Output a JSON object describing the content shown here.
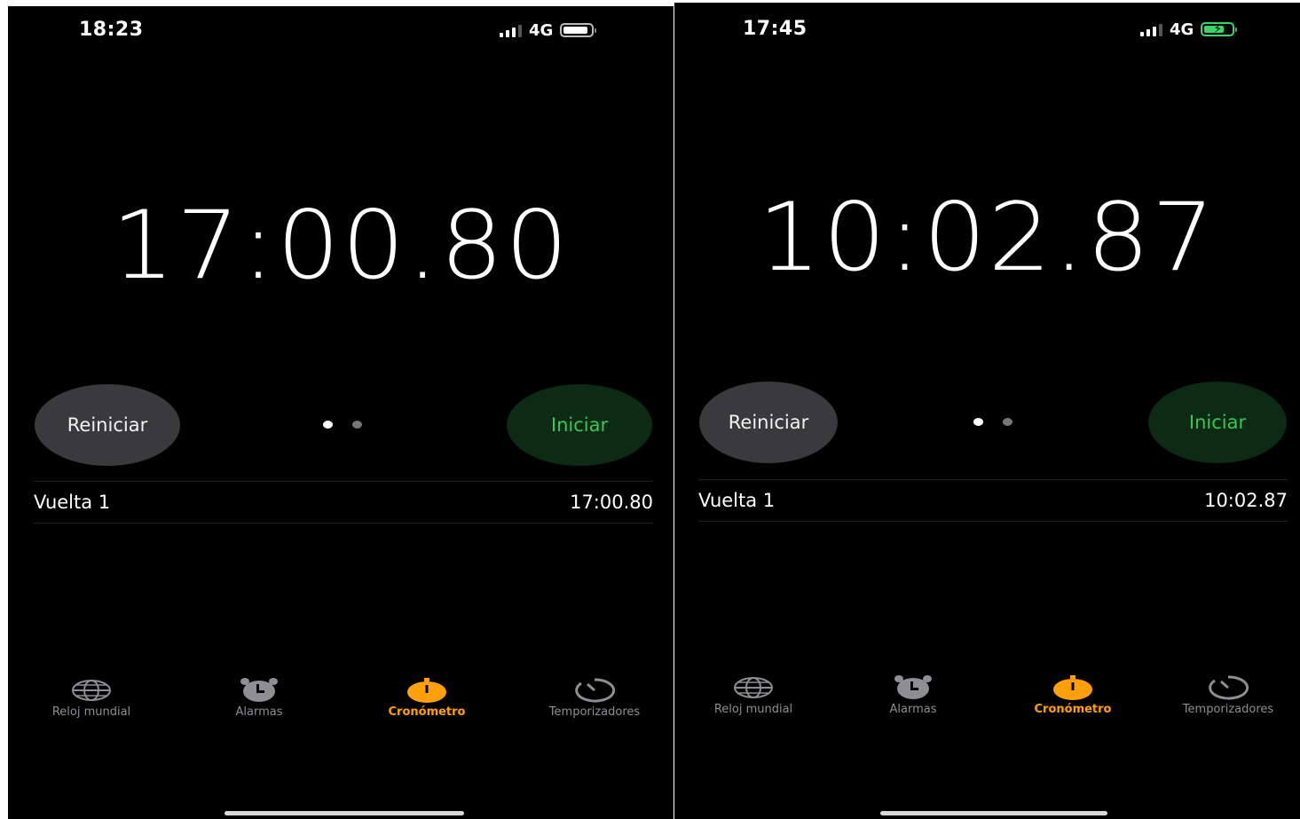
{
  "screens": [
    {
      "status": {
        "time": "18:23",
        "network": "4G",
        "battery_level": 0.9,
        "charging": false
      },
      "stopwatch": {
        "display": "17:00.80"
      },
      "buttons": {
        "reset": "Reiniciar",
        "start": "Iniciar"
      },
      "page_dots": {
        "count": 2,
        "active_index": 0
      },
      "laps": [
        {
          "label": "Vuelta 1",
          "time": "17:00.80"
        }
      ],
      "tabs": [
        {
          "label": "Reloj mundial",
          "icon": "globe-icon",
          "active": false
        },
        {
          "label": "Alarmas",
          "icon": "alarm-clock-icon",
          "active": false
        },
        {
          "label": "Cronómetro",
          "icon": "stopwatch-icon",
          "active": true
        },
        {
          "label": "Temporizadores",
          "icon": "timer-icon",
          "active": false
        }
      ]
    },
    {
      "status": {
        "time": "17:45",
        "network": "4G",
        "battery_level": 0.75,
        "charging": true
      },
      "stopwatch": {
        "display": "10:02.87"
      },
      "buttons": {
        "reset": "Reiniciar",
        "start": "Iniciar"
      },
      "page_dots": {
        "count": 2,
        "active_index": 0
      },
      "laps": [
        {
          "label": "Vuelta 1",
          "time": "10:02.87"
        }
      ],
      "tabs": [
        {
          "label": "Reloj mundial",
          "icon": "globe-icon",
          "active": false
        },
        {
          "label": "Alarmas",
          "icon": "alarm-clock-icon",
          "active": false
        },
        {
          "label": "Cronómetro",
          "icon": "stopwatch-icon",
          "active": true
        },
        {
          "label": "Temporizadores",
          "icon": "timer-icon",
          "active": false
        }
      ]
    }
  ],
  "colors": {
    "background": "#000000",
    "accent_active_tab": "#ff9f0a",
    "start_button_text": "#35c759",
    "start_button_bg": "#0c2a14",
    "reset_button_bg": "#3a3a3c",
    "inactive_tab": "#8e8e93"
  }
}
